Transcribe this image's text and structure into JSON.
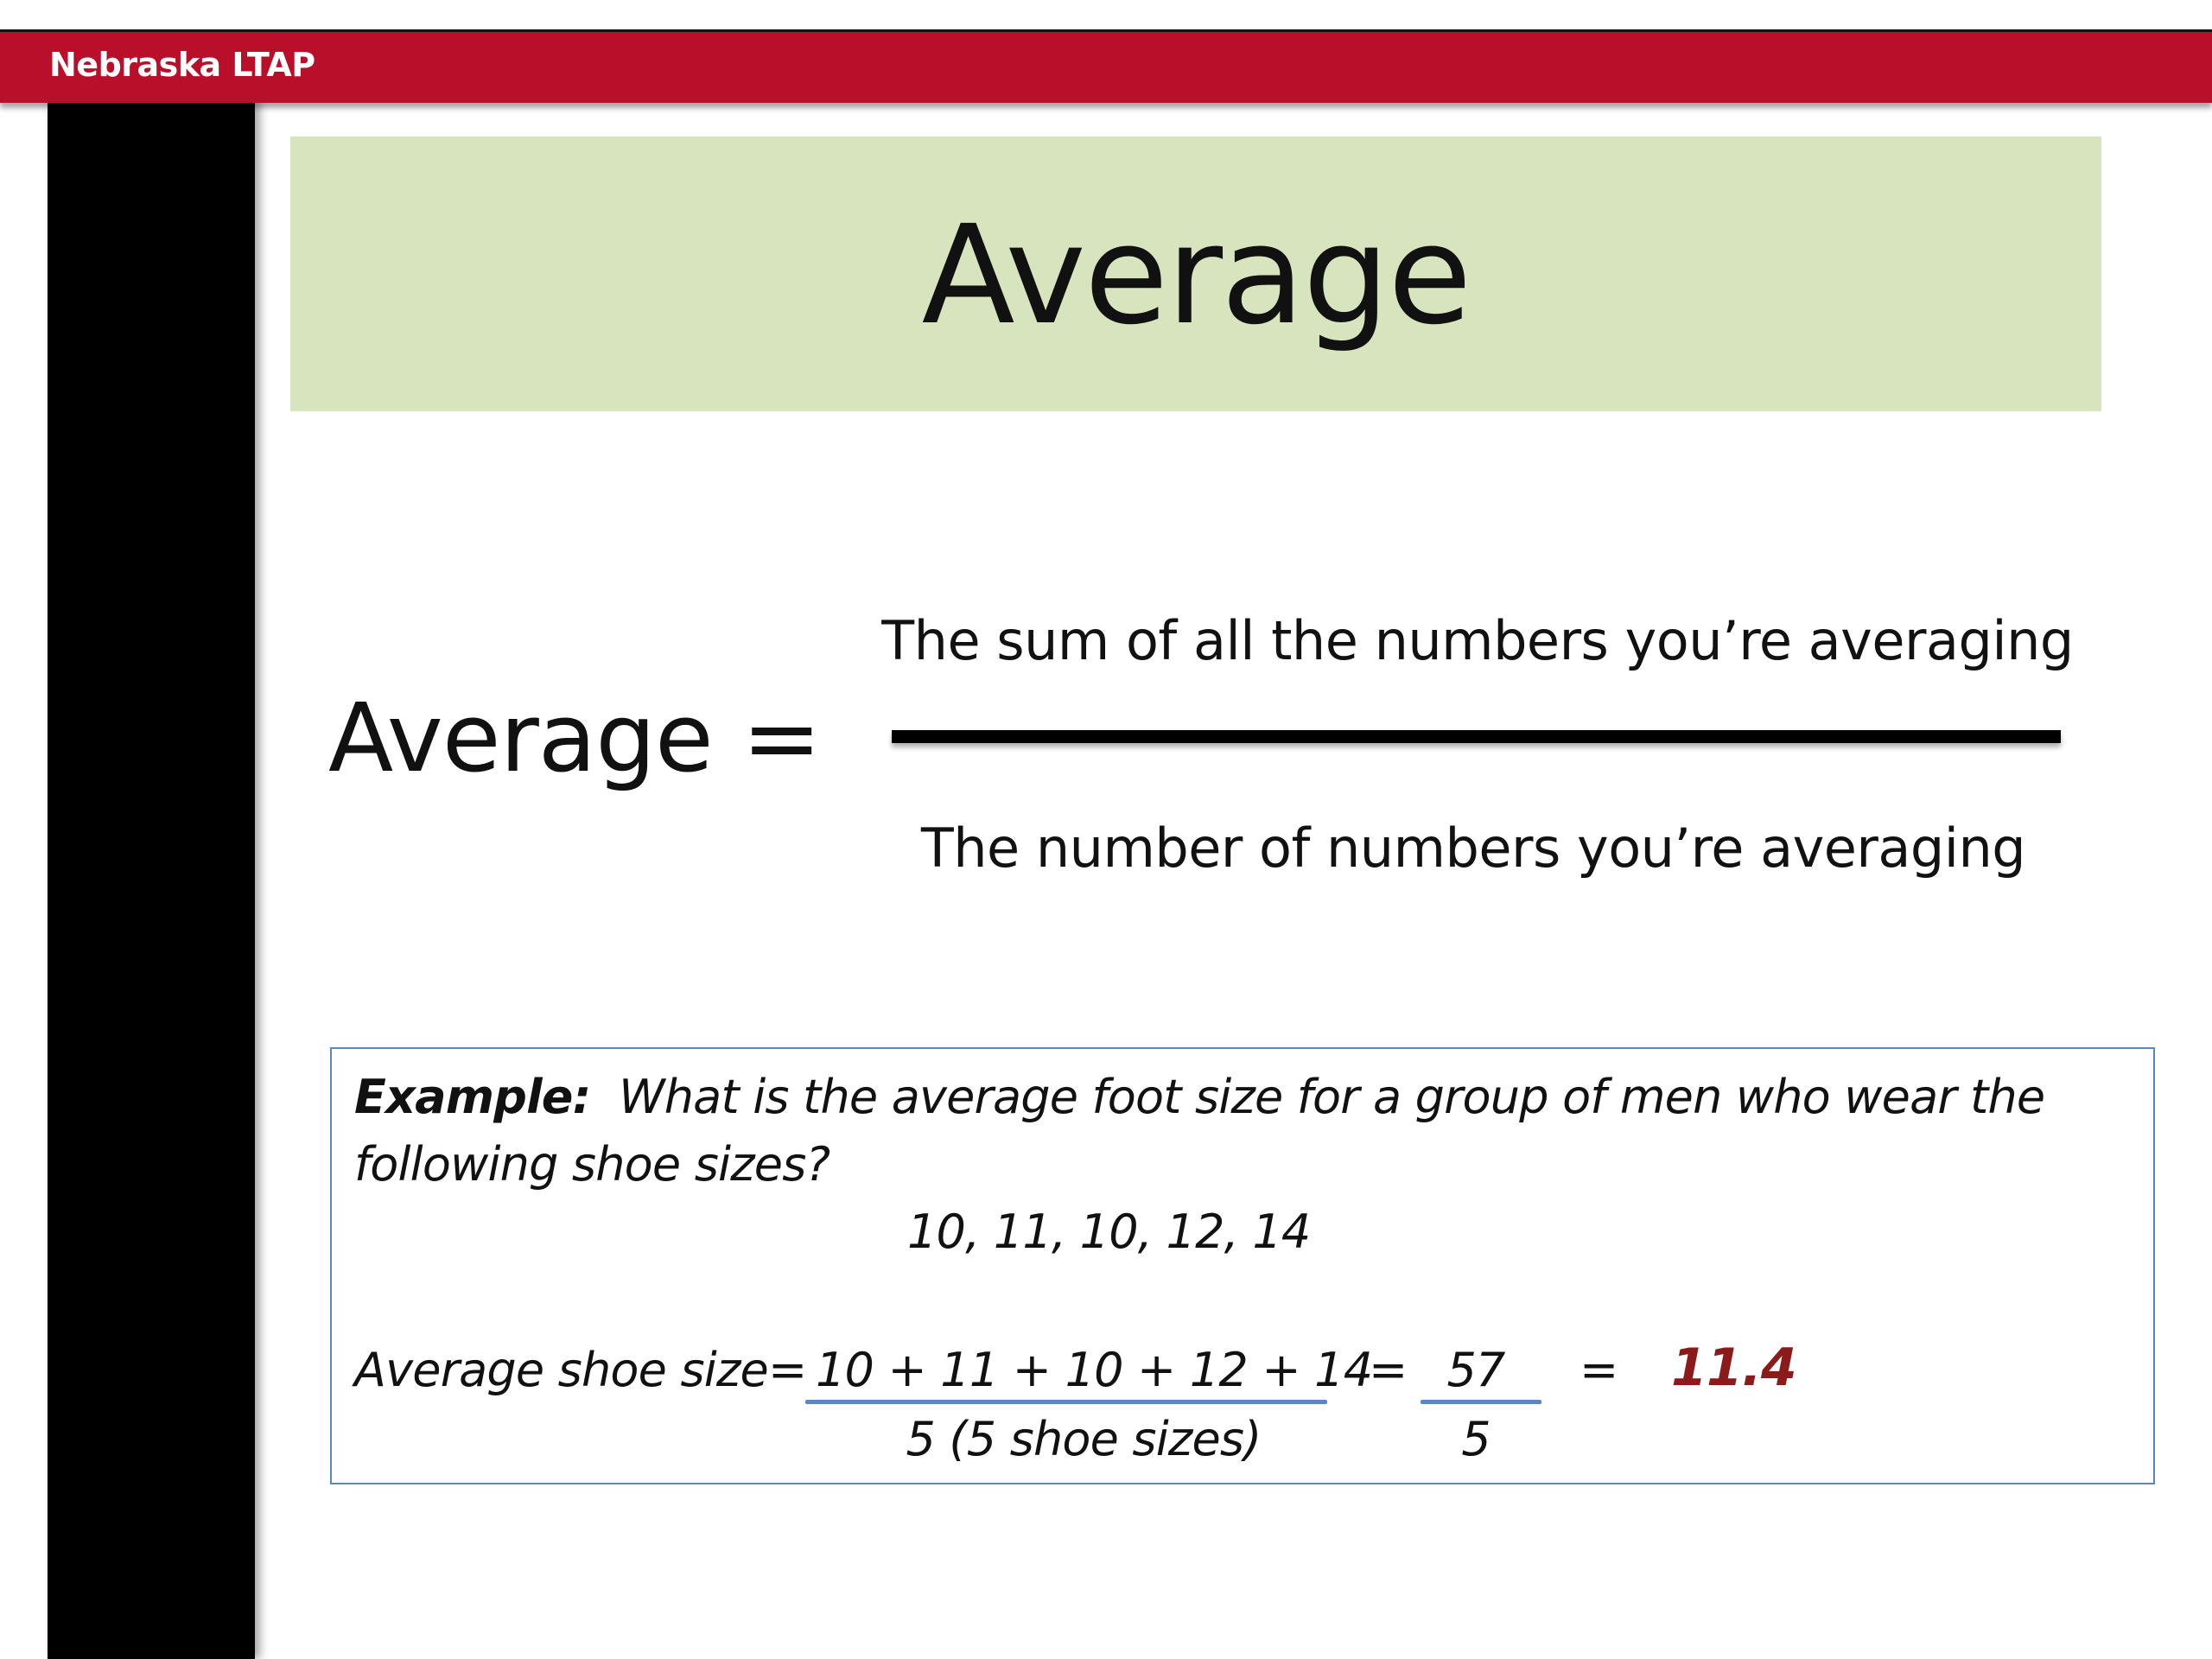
{
  "header": {
    "org_name": "Nebraska LTAP"
  },
  "slide": {
    "title": "Average",
    "formula": {
      "lhs": "Average =",
      "numerator": "The sum of all the numbers you’re averaging",
      "denominator": "The number of numbers you’re averaging"
    },
    "example": {
      "label": "Example:",
      "question_line1": "What is the average foot size for a group of men who wear the",
      "question_line2": "following shoe sizes?",
      "values": "10, 11, 10, 12, 14",
      "avg_label": "Average shoe size=",
      "sum_expression": "10 + 11 + 10 + 12 + 14",
      "divisor_expression": "5 (5 shoe sizes)",
      "equals_1": "=",
      "sum_result": "57",
      "divisor_result": "5",
      "equals_2": "=",
      "final_result": "11.4"
    }
  },
  "colors": {
    "header_red": "#b90f2a",
    "title_green": "#d7e4bd",
    "accent_blue": "#5b86c5",
    "result_red": "#8b1a1a"
  }
}
